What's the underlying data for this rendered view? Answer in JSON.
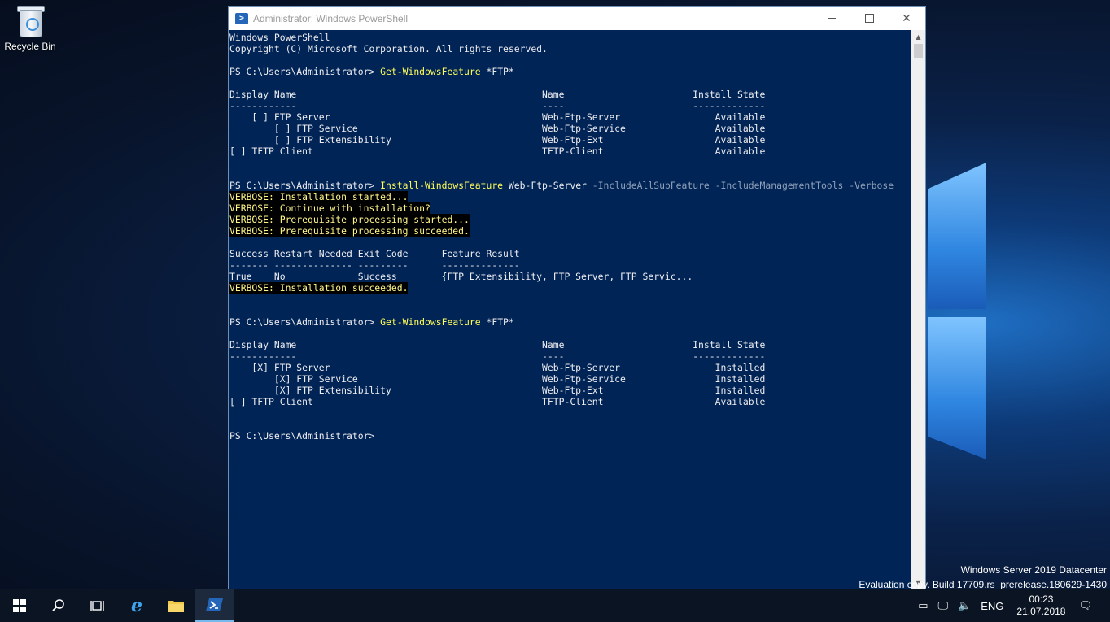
{
  "desktop": {
    "recycle_bin_label": "Recycle Bin"
  },
  "window": {
    "title": "Administrator: Windows PowerShell"
  },
  "console_lines": [
    {
      "segs": [
        {
          "t": "Windows PowerShell",
          "c": ""
        }
      ]
    },
    {
      "segs": [
        {
          "t": "Copyright (C) Microsoft Corporation. All rights reserved.",
          "c": ""
        }
      ]
    },
    {
      "segs": [
        {
          "t": "",
          "c": ""
        }
      ]
    },
    {
      "segs": [
        {
          "t": "PS C:\\Users\\Administrator> ",
          "c": ""
        },
        {
          "t": "Get-WindowsFeature",
          "c": "y"
        },
        {
          "t": " *FTP*",
          "c": ""
        }
      ]
    },
    {
      "segs": [
        {
          "t": "",
          "c": ""
        }
      ]
    },
    {
      "segs": [
        {
          "t": "Display Name                                            Name                       Install State",
          "c": ""
        }
      ]
    },
    {
      "segs": [
        {
          "t": "------------                                            ----                       -------------",
          "c": ""
        }
      ]
    },
    {
      "segs": [
        {
          "t": "    [ ] FTP Server                                      Web-Ftp-Server                 Available",
          "c": ""
        }
      ]
    },
    {
      "segs": [
        {
          "t": "        [ ] FTP Service                                 Web-Ftp-Service                Available",
          "c": ""
        }
      ]
    },
    {
      "segs": [
        {
          "t": "        [ ] FTP Extensibility                           Web-Ftp-Ext                    Available",
          "c": ""
        }
      ]
    },
    {
      "segs": [
        {
          "t": "[ ] TFTP Client                                         TFTP-Client                    Available",
          "c": ""
        }
      ]
    },
    {
      "segs": [
        {
          "t": "",
          "c": ""
        }
      ]
    },
    {
      "segs": [
        {
          "t": "",
          "c": ""
        }
      ]
    },
    {
      "segs": [
        {
          "t": "PS C:\\Users\\Administrator> ",
          "c": ""
        },
        {
          "t": "Install-WindowsFeature",
          "c": "y"
        },
        {
          "t": " Web-Ftp-Server ",
          "c": ""
        },
        {
          "t": "-IncludeAllSubFeature -IncludeManagementTools -Verbose",
          "c": "g"
        }
      ]
    },
    {
      "segs": [
        {
          "t": "VERBOSE: Installation started...",
          "c": "vb"
        }
      ]
    },
    {
      "segs": [
        {
          "t": "VERBOSE: Continue with installation?",
          "c": "vb"
        }
      ]
    },
    {
      "segs": [
        {
          "t": "VERBOSE: Prerequisite processing started...",
          "c": "vb"
        }
      ]
    },
    {
      "segs": [
        {
          "t": "VERBOSE: Prerequisite processing succeeded.",
          "c": "vb"
        }
      ]
    },
    {
      "segs": [
        {
          "t": "",
          "c": ""
        }
      ]
    },
    {
      "segs": [
        {
          "t": "Success Restart Needed Exit Code      Feature Result",
          "c": ""
        }
      ]
    },
    {
      "segs": [
        {
          "t": "------- -------------- ---------      --------------",
          "c": ""
        }
      ]
    },
    {
      "segs": [
        {
          "t": "True    No             Success        {FTP Extensibility, FTP Server, FTP Servic...",
          "c": ""
        }
      ]
    },
    {
      "segs": [
        {
          "t": "VERBOSE: Installation succeeded.",
          "c": "vb"
        }
      ]
    },
    {
      "segs": [
        {
          "t": "",
          "c": ""
        }
      ]
    },
    {
      "segs": [
        {
          "t": "",
          "c": ""
        }
      ]
    },
    {
      "segs": [
        {
          "t": "PS C:\\Users\\Administrator> ",
          "c": ""
        },
        {
          "t": "Get-WindowsFeature",
          "c": "y"
        },
        {
          "t": " *FTP*",
          "c": ""
        }
      ]
    },
    {
      "segs": [
        {
          "t": "",
          "c": ""
        }
      ]
    },
    {
      "segs": [
        {
          "t": "Display Name                                            Name                       Install State",
          "c": ""
        }
      ]
    },
    {
      "segs": [
        {
          "t": "------------                                            ----                       -------------",
          "c": ""
        }
      ]
    },
    {
      "segs": [
        {
          "t": "    [X] FTP Server                                      Web-Ftp-Server                 Installed",
          "c": ""
        }
      ]
    },
    {
      "segs": [
        {
          "t": "        [X] FTP Service                                 Web-Ftp-Service                Installed",
          "c": ""
        }
      ]
    },
    {
      "segs": [
        {
          "t": "        [X] FTP Extensibility                           Web-Ftp-Ext                    Installed",
          "c": ""
        }
      ]
    },
    {
      "segs": [
        {
          "t": "[ ] TFTP Client                                         TFTP-Client                    Available",
          "c": ""
        }
      ]
    },
    {
      "segs": [
        {
          "t": "",
          "c": ""
        }
      ]
    },
    {
      "segs": [
        {
          "t": "",
          "c": ""
        }
      ]
    },
    {
      "segs": [
        {
          "t": "PS C:\\Users\\Administrator>",
          "c": ""
        }
      ]
    }
  ],
  "watermark": {
    "line1": "Windows Server 2019 Datacenter",
    "line2": "Evaluation copy. Build 17709.rs_prerelease.180629-1430"
  },
  "taskbar": {
    "language": "ENG",
    "time": "00:23",
    "date": "21.07.2018"
  }
}
